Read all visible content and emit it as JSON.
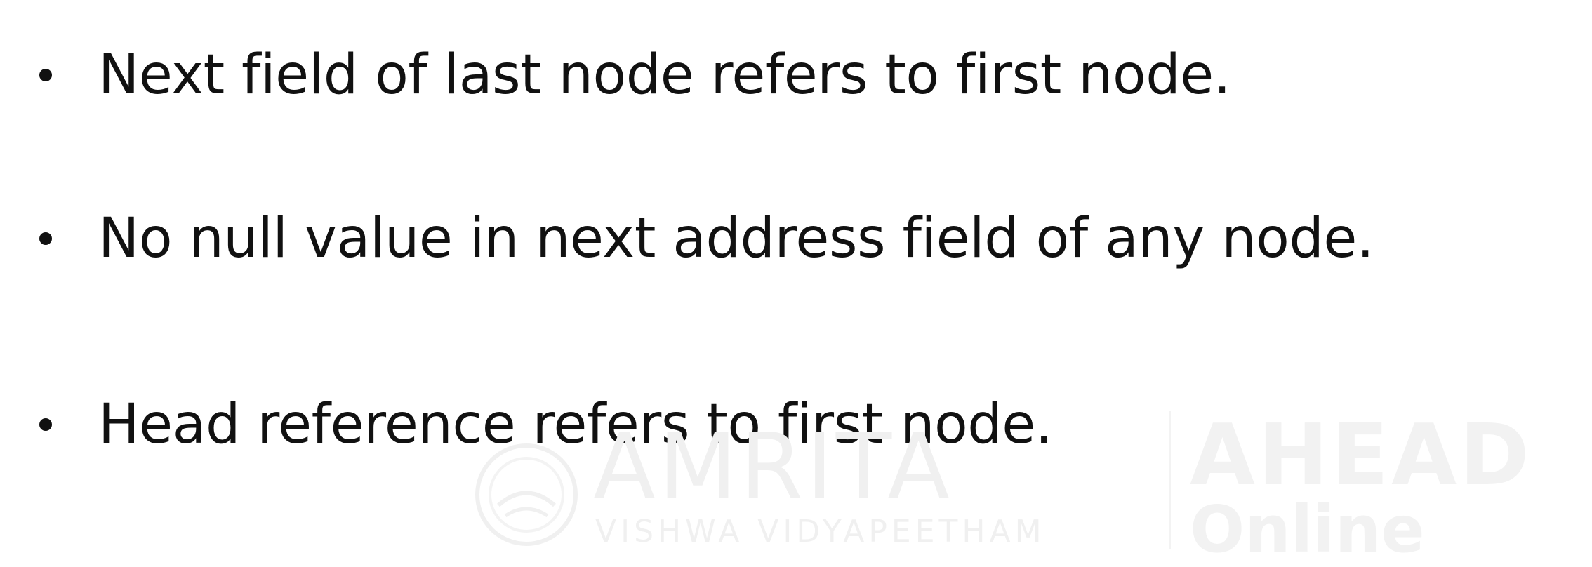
{
  "bullets": [
    {
      "text": "Next field of last node refers to first node."
    },
    {
      "text": "No null value in next address field of any node."
    },
    {
      "text": "Head reference refers to first node."
    }
  ],
  "watermark": {
    "brand": "AMRITA",
    "tagline": "VISHWA VIDYAPEETHAM",
    "product": "AHEAD",
    "product_sub": "Online"
  },
  "colors": {
    "text": "#111111",
    "background": "#ffffff",
    "watermark": "#f0f0f0"
  }
}
